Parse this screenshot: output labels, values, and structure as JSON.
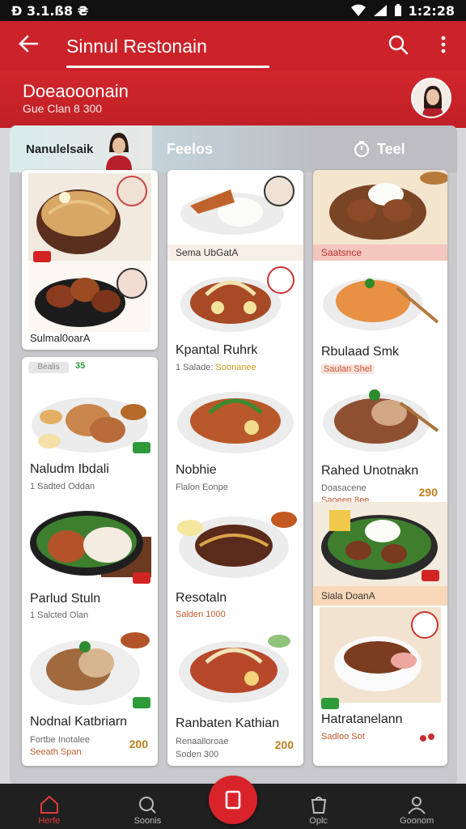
{
  "status_bar": {
    "left": "Ð 3.1.ß8 ₴",
    "time": "1:2:28"
  },
  "app_bar": {
    "title": "Sinnul Restonain"
  },
  "header": {
    "title": "Doeaooonain",
    "subtitle": "Gue Clan 8 300"
  },
  "tabs": [
    {
      "label": "Nanulelsaik"
    },
    {
      "label": "Feelos"
    },
    {
      "label": "Teel"
    }
  ],
  "cards": {
    "c1": {
      "title": "Sulmal0oarA"
    },
    "c2": {
      "tag": "Bealis",
      "tag_num": "35",
      "title": "Naludm Ibdali",
      "sub": "1 Sadted Oddan"
    },
    "c3": {
      "title": "Parlud Stuln",
      "sub": "1 Salcted Olan"
    },
    "c4": {
      "title": "Nodnal Katbriarn",
      "sub": "Fortbe Inotalee",
      "sub2": "Seeath Span",
      "price": "200"
    },
    "m1": {
      "banner": "Sema UbGatA"
    },
    "m2": {
      "title": "Kpantal Ruhrk",
      "sub": "1 Salade:",
      "sub_accent": "Soonanee"
    },
    "m3": {
      "title": "Nobhie",
      "sub": "Flalon Eonpe"
    },
    "m4": {
      "title": "Resotaln",
      "sub2": "Salden 1000"
    },
    "m5": {
      "title": "Ranbaten Kathian",
      "sub": "Renaalloroae",
      "sub2": "Soden 300",
      "price": "200"
    },
    "r1": {
      "banner": "Saatsnce"
    },
    "r2": {
      "title": "Rbulaad Smk",
      "sub2": "Saulan Shel"
    },
    "r3": {
      "title": "Rahed Unotnakn",
      "sub": "Doasacene",
      "sub2": "Saoeen 8ee",
      "price": "290"
    },
    "r4": {
      "banner": "Siala DoanA"
    },
    "r5": {
      "title": "Hatratanelann",
      "sub2": "Sadloo Sot"
    }
  },
  "bottom_nav": [
    {
      "label": "Herfe",
      "icon": "home-icon"
    },
    {
      "label": "Soonis",
      "icon": "search-icon"
    },
    {
      "label": "Oplc",
      "icon": "bag-icon"
    },
    {
      "label": "Goonom",
      "icon": "profile-icon"
    }
  ]
}
